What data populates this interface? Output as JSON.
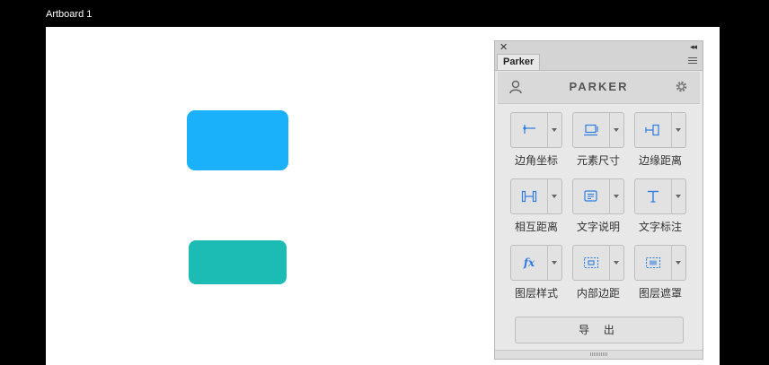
{
  "artboard": {
    "label": "Artboard 1"
  },
  "shapes": {
    "blue_color": "#1ab1fa",
    "teal_color": "#1cbcb5"
  },
  "panel": {
    "tab_title": "Parker",
    "header_title": "PARKER",
    "accent_color": "#2d7ce0",
    "tools": [
      {
        "label": "边角坐标",
        "icon": "corner-coordinate-icon"
      },
      {
        "label": "元素尺寸",
        "icon": "element-size-icon"
      },
      {
        "label": "边缘距离",
        "icon": "edge-distance-icon"
      },
      {
        "label": "相互距离",
        "icon": "mutual-distance-icon"
      },
      {
        "label": "文字说明",
        "icon": "text-note-icon"
      },
      {
        "label": "文字标注",
        "icon": "text-annotation-icon"
      },
      {
        "label": "图层样式",
        "icon": "layer-style-icon"
      },
      {
        "label": "内部边距",
        "icon": "inner-padding-icon"
      },
      {
        "label": "图层遮罩",
        "icon": "layer-mask-icon"
      }
    ],
    "export_label": "导 出"
  }
}
